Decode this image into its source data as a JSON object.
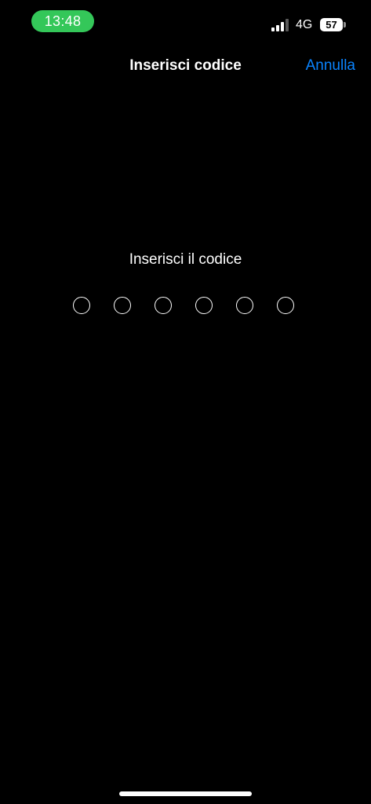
{
  "status_bar": {
    "time": "13:48",
    "network": "4G",
    "battery_level": "57",
    "signal_icon": "signal-bars-icon",
    "battery_icon": "battery-icon",
    "time_pill_color": "#34c759"
  },
  "nav": {
    "title": "Inserisci codice",
    "cancel_label": "Annulla",
    "accent_color": "#0a84ff"
  },
  "passcode": {
    "prompt": "Inserisci il codice",
    "length": 6,
    "filled": 0
  },
  "theme": {
    "background": "#000000",
    "text": "#ffffff"
  }
}
